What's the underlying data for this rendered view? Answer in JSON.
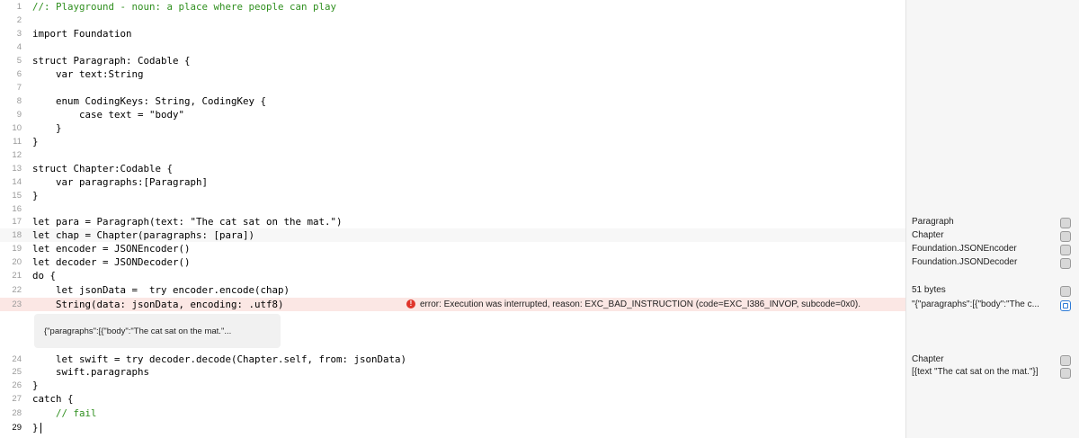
{
  "lines": [
    {
      "n": "1",
      "code": "//: Playground - noun: a place where people can play"
    },
    {
      "n": "2",
      "code": ""
    },
    {
      "n": "3",
      "code": "import Foundation"
    },
    {
      "n": "4",
      "code": ""
    },
    {
      "n": "5",
      "code": "struct Paragraph: Codable {"
    },
    {
      "n": "6",
      "code": "    var text:String"
    },
    {
      "n": "7",
      "code": ""
    },
    {
      "n": "8",
      "code": "    enum CodingKeys: String, CodingKey {"
    },
    {
      "n": "9",
      "code": "        case text = \"body\""
    },
    {
      "n": "10",
      "code": "    }"
    },
    {
      "n": "11",
      "code": "}"
    },
    {
      "n": "12",
      "code": ""
    },
    {
      "n": "13",
      "code": "struct Chapter:Codable {"
    },
    {
      "n": "14",
      "code": "    var paragraphs:[Paragraph]"
    },
    {
      "n": "15",
      "code": "}"
    },
    {
      "n": "16",
      "code": ""
    },
    {
      "n": "17",
      "code": "let para = Paragraph(text: \"The cat sat on the mat.\")"
    },
    {
      "n": "18",
      "code": "let chap = Chapter(paragraphs: [para])"
    },
    {
      "n": "19",
      "code": "let encoder = JSONEncoder()"
    },
    {
      "n": "20",
      "code": "let decoder = JSONDecoder()"
    },
    {
      "n": "21",
      "code": "do {"
    },
    {
      "n": "22",
      "code": "    let jsonData =  try encoder.encode(chap)"
    },
    {
      "n": "23",
      "code": "    String(data: jsonData, encoding: .utf8)"
    },
    {
      "n": "24",
      "code": "    let swift = try decoder.decode(Chapter.self, from: jsonData)"
    },
    {
      "n": "25",
      "code": "    swift.paragraphs"
    },
    {
      "n": "26",
      "code": "}"
    },
    {
      "n": "27",
      "code": "catch {"
    },
    {
      "n": "28",
      "code": "    // fail"
    },
    {
      "n": "29",
      "code": "}"
    }
  ],
  "error": {
    "message": "error: Execution was interrupted, reason: EXC_BAD_INSTRUCTION (code=EXC_I386_INVOP, subcode=0x0)."
  },
  "popup": {
    "text": "{\"paragraphs\":[{\"body\":\"The cat sat on the mat.\"..."
  },
  "sidebar": {
    "results": [
      {
        "line": "17",
        "text": "Paragraph"
      },
      {
        "line": "18",
        "text": "Chapter"
      },
      {
        "line": "19",
        "text": "Foundation.JSONEncoder"
      },
      {
        "line": "20",
        "text": "Foundation.JSONDecoder"
      },
      {
        "line": "22",
        "text": "51 bytes"
      },
      {
        "line": "23",
        "text": "\"{\"paragraphs\":[{\"body\":\"The c..."
      },
      {
        "line": "24",
        "text": "Chapter"
      },
      {
        "line": "25",
        "text": "[{text \"The cat sat on the mat.\"}]"
      }
    ]
  }
}
